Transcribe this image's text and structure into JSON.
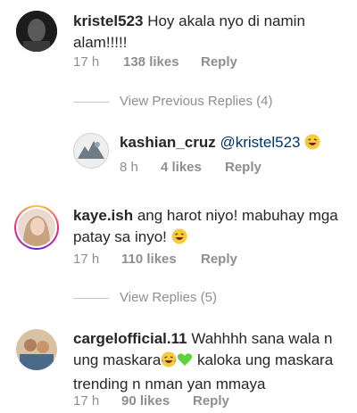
{
  "comments": [
    {
      "username": "kristel523",
      "text": "Hoy akala nyo di namin alam!!!!!",
      "time": "17 h",
      "likes": "138 likes",
      "reply": "Reply"
    },
    {
      "username": "kashian_cruz",
      "text": "@kristel523",
      "emoji": "laughing-face",
      "time": "8 h",
      "likes": "4 likes",
      "reply": "Reply"
    },
    {
      "username": "kaye.ish",
      "text": "ang harot niyo! mabuhay mga patay sa inyo!",
      "emoji": "laughing-face",
      "time": "17 h",
      "likes": "110 likes",
      "reply": "Reply"
    },
    {
      "username": "cargelofficial.11",
      "text_a": "Wahhhh sana wala n ung maskara",
      "text_b": "kaloka ung maskara trending n nman yan mmaya",
      "emojis": [
        "crying-laughing-face",
        "green-heart"
      ],
      "time": "17 h",
      "likes": "90 likes",
      "reply": "Reply"
    }
  ],
  "view_replies": [
    {
      "label": "View Previous Replies (4)"
    },
    {
      "label": "View Replies (5)"
    }
  ],
  "colors": {
    "text": "#262626",
    "meta": "#8e8e8e",
    "story_ring": "#e1306c",
    "divider": "#c7c7c7"
  }
}
